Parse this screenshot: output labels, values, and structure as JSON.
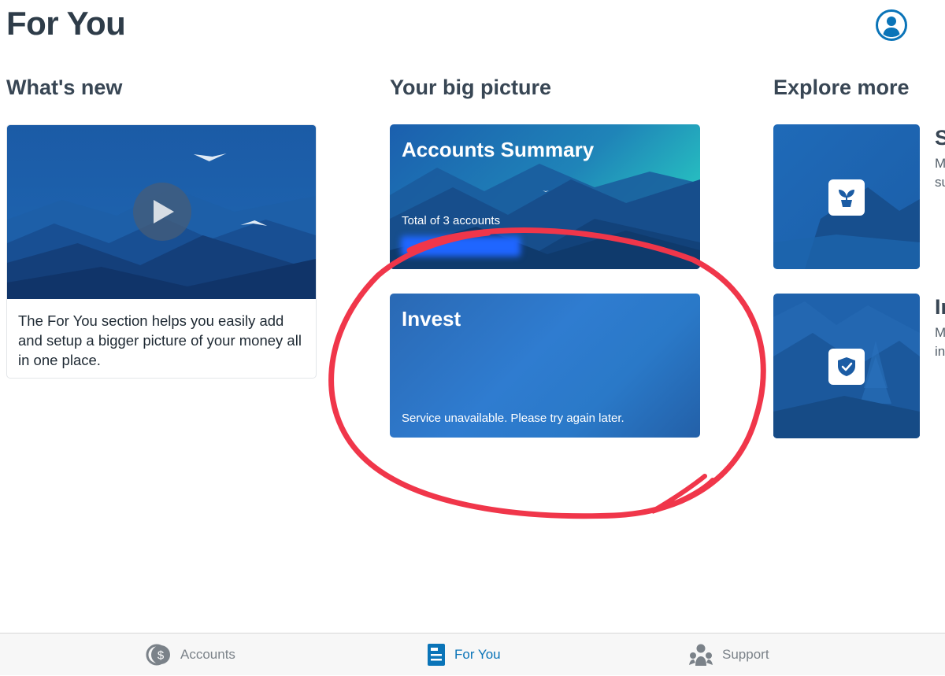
{
  "header": {
    "title": "For You",
    "profile_icon": "user-circle-icon"
  },
  "whats_new": {
    "heading": "What's new",
    "card": {
      "description": "The For You section helps you easily add and setup a bigger picture of your money all in one place.",
      "play_icon": "play-icon"
    }
  },
  "big_picture": {
    "heading": "Your big picture",
    "accounts_summary": {
      "title": "Accounts Summary",
      "subtitle": "Total of 3 accounts"
    },
    "invest": {
      "title": "Invest",
      "status": "Service unavailable. Please try again later."
    }
  },
  "explore_more": {
    "heading": "Explore more",
    "cards": [
      {
        "icon": "plant-icon",
        "title_peek": "S",
        "line1_peek": "M",
        "line2_peek": "su"
      },
      {
        "icon": "shield-check-icon",
        "title_peek": "In",
        "line1_peek": "M",
        "line2_peek": "in"
      }
    ]
  },
  "tabbar": {
    "tabs": [
      {
        "label": "Accounts",
        "icon": "dollar-coin-icon",
        "active": false
      },
      {
        "label": "For You",
        "icon": "for-you-icon",
        "active": true
      },
      {
        "label": "Support",
        "icon": "support-icon",
        "active": false
      }
    ]
  },
  "colors": {
    "accent": "#0a74b8",
    "tab_inactive": "#7b8289",
    "annotation": "#f0364a",
    "card_blue": "#1e5aa3"
  }
}
